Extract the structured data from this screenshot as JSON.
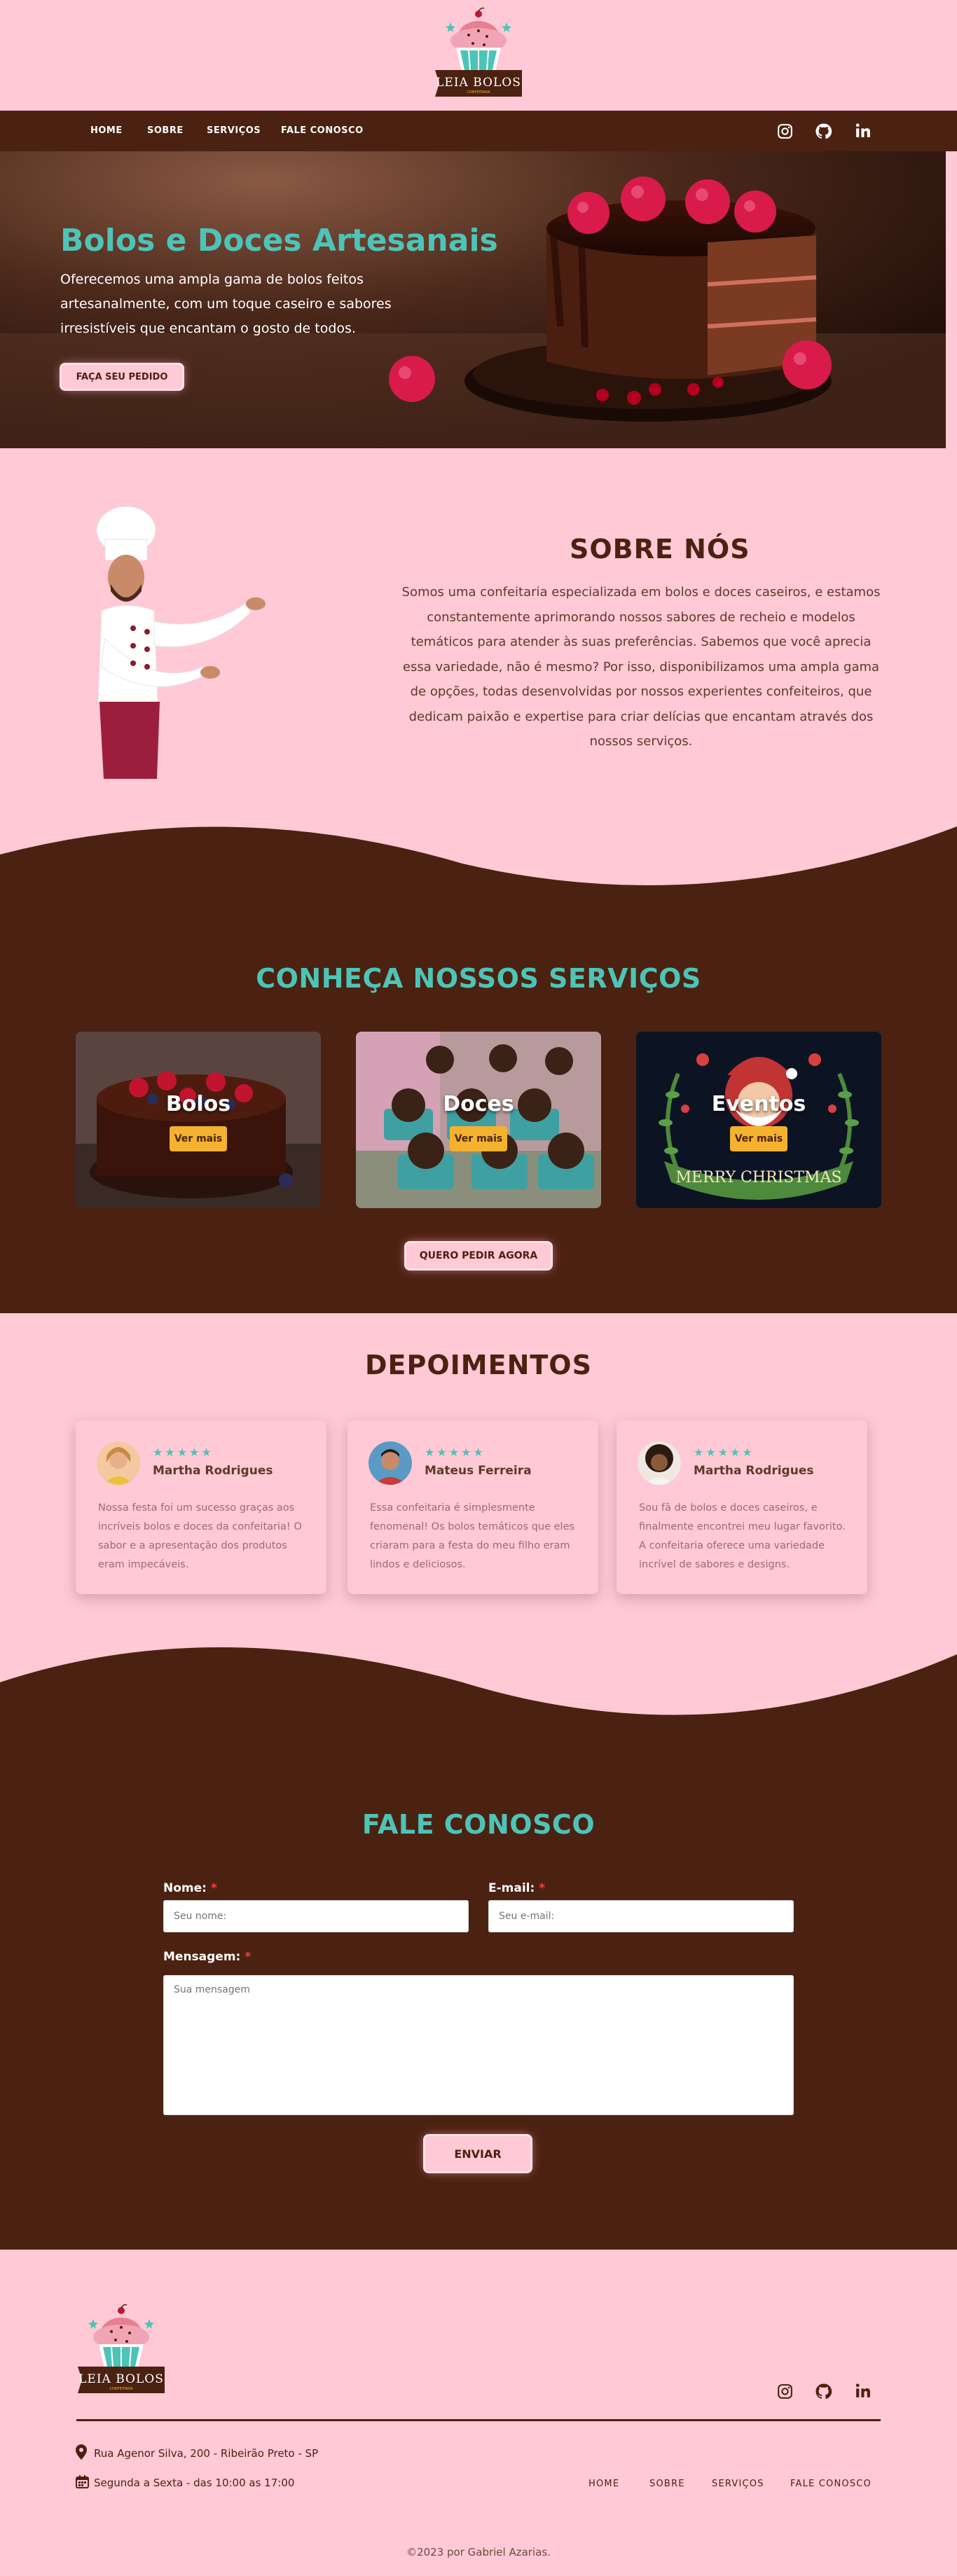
{
  "brand": {
    "name": "LEIA BOLOS",
    "tagline": "CONFEITARIA"
  },
  "nav": {
    "links": [
      "HOME",
      "SOBRE",
      "SERVIÇOS",
      "FALE CONOSCO"
    ],
    "social_icons": [
      "instagram-icon",
      "github-icon",
      "linkedin-icon"
    ]
  },
  "hero": {
    "title": "Bolos e Doces Artesanais",
    "text": "Oferecemos uma ampla gama de bolos feitos artesanalmente, com um toque caseiro e sabores irresistíveis que encantam o gosto de todos.",
    "button": "FAÇA SEU PEDIDO"
  },
  "about": {
    "title": "SOBRE NÓS",
    "text": "Somos uma confeitaria especializada em bolos e doces caseiros, e estamos constantemente aprimorando nossos sabores de recheio e modelos temáticos para atender às suas preferências. Sabemos que você aprecia essa variedade, não é mesmo? Por isso, disponibilizamos uma ampla gama de opções, todas desenvolvidas por nossos experientes confeiteiros, que dedicam paixão e expertise para criar delícias que encantam através dos nossos serviços."
  },
  "services": {
    "title": "CONHEÇA NOSSOS SERVIÇOS",
    "cards": [
      {
        "title": "Bolos",
        "button": "Ver mais"
      },
      {
        "title": "Doces",
        "button": "Ver mais"
      },
      {
        "title": "Eventos",
        "button": "Ver mais"
      }
    ],
    "card3_banner": "MERRY CHRISTMAS",
    "cta": "QUERO PEDIR AGORA"
  },
  "testimonials": {
    "title": "DEPOIMENTOS",
    "stars": "★★★★★",
    "items": [
      {
        "name": "Martha Rodrigues",
        "text": "Nossa festa foi um sucesso graças aos incríveis bolos e doces da confeitaria! O sabor e a apresentação dos produtos eram impecáveis."
      },
      {
        "name": "Mateus Ferreira",
        "text": "Essa confeitaria é simplesmente fenomenal! Os bolos temáticos que eles criaram para a festa do meu filho eram lindos e deliciosos."
      },
      {
        "name": "Martha Rodrigues",
        "text": "Sou fã de bolos e doces caseiros, e finalmente encontrei meu lugar favorito. A confeitaria oferece uma variedade incrível de sabores e designs."
      }
    ]
  },
  "contact": {
    "title": "FALE CONOSCO",
    "name_label": "Nome:",
    "name_placeholder": "Seu nome:",
    "email_label": "E-mail:",
    "email_placeholder": "Seu e-mail:",
    "message_label": "Mensagem:",
    "message_placeholder": "Sua mensagem",
    "required_mark": "*",
    "submit": "ENVIAR"
  },
  "footer": {
    "address": "Rua Agenor Silva, 200 - Ribeirão Preto - SP",
    "hours": "Segunda a Sexta - das 10:00 as 17:00",
    "links": [
      "HOME",
      "SOBRE",
      "SERVIÇOS",
      "FALE CONOSCO"
    ],
    "copyright": "©2023 por Gabriel Azarias."
  },
  "colors": {
    "pink": "#ffc9d5",
    "brown": "#4b2211",
    "teal": "#4dc4b7",
    "yellow": "#f4b22e"
  }
}
